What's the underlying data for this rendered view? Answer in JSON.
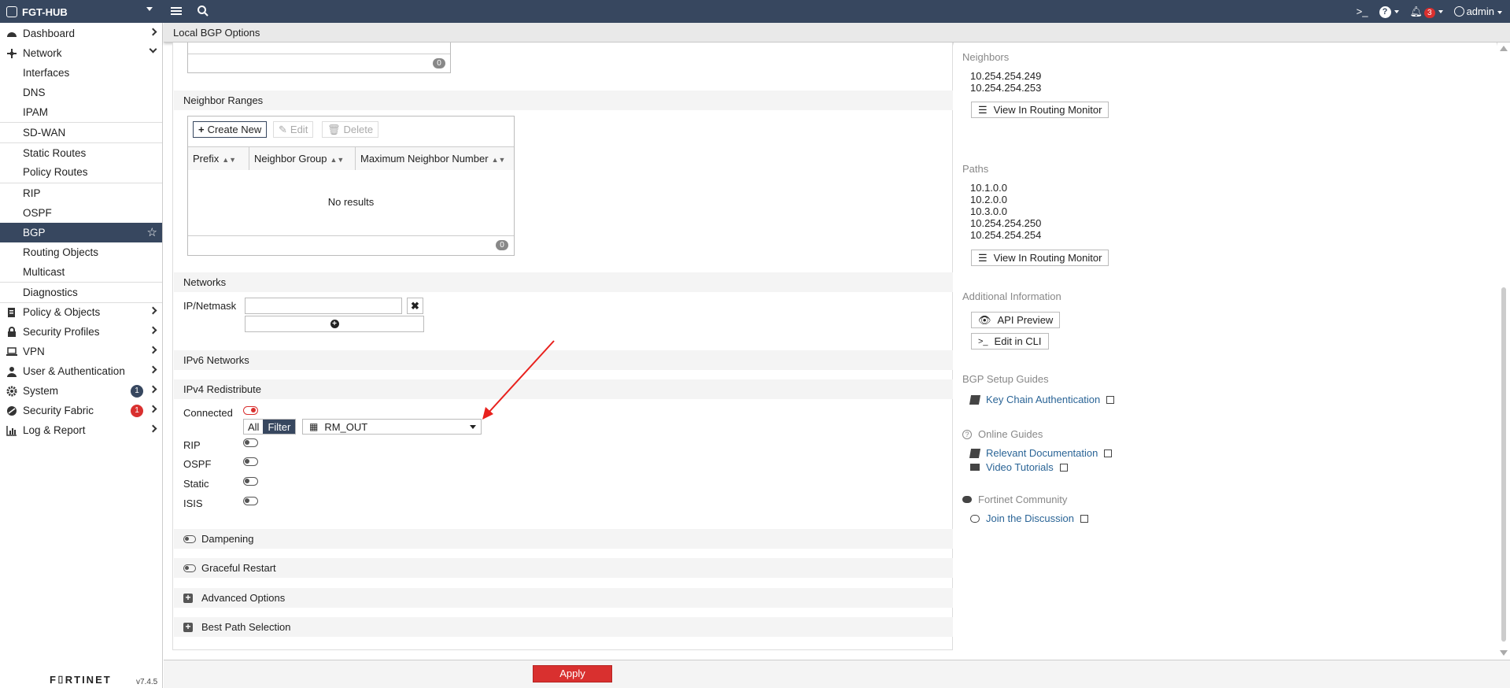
{
  "topbar": {
    "device_name": "FGT-HUB",
    "cli_label": ">_",
    "help_label": "?",
    "notification_count": "3",
    "user": "admin"
  },
  "sidebar": {
    "items": [
      {
        "label": "Dashboard"
      },
      {
        "label": "Network"
      },
      {
        "label": "Interfaces"
      },
      {
        "label": "DNS"
      },
      {
        "label": "IPAM"
      },
      {
        "label": "SD-WAN"
      },
      {
        "label": "Static Routes"
      },
      {
        "label": "Policy Routes"
      },
      {
        "label": "RIP"
      },
      {
        "label": "OSPF"
      },
      {
        "label": "BGP"
      },
      {
        "label": "Routing Objects"
      },
      {
        "label": "Multicast"
      },
      {
        "label": "Diagnostics"
      },
      {
        "label": "Policy & Objects"
      },
      {
        "label": "Security Profiles"
      },
      {
        "label": "VPN"
      },
      {
        "label": "User & Authentication"
      },
      {
        "label": "System",
        "badge": "1"
      },
      {
        "label": "Security Fabric",
        "badge": "1"
      },
      {
        "label": "Log & Report"
      }
    ],
    "logo": "F⌷RTINET",
    "version": "v7.4.5"
  },
  "page": {
    "title": "Local BGP Options",
    "top_count": "0",
    "neighbor_ranges": {
      "title": "Neighbor Ranges",
      "create_label": "Create New",
      "edit_label": "Edit",
      "delete_label": "Delete",
      "columns": [
        "Prefix",
        "Neighbor Group",
        "Maximum Neighbor Number"
      ],
      "empty_text": "No results",
      "count": "0"
    },
    "networks": {
      "title": "Networks",
      "ipnetmask_label": "IP/Netmask",
      "ipnetmask_value": ""
    },
    "ipv6_networks": {
      "title": "IPv6 Networks"
    },
    "ipv4_redistribute": {
      "title": "IPv4 Redistribute",
      "connected_label": "Connected",
      "all_label": "All",
      "filter_label": "Filter",
      "route_map": "RM_OUT",
      "rip_label": "RIP",
      "ospf_label": "OSPF",
      "static_label": "Static",
      "isis_label": "ISIS"
    },
    "dampening": "Dampening",
    "graceful_restart": "Graceful Restart",
    "advanced_options": "Advanced Options",
    "best_path_selection": "Best Path Selection",
    "apply_label": "Apply"
  },
  "right_panel": {
    "neighbors_title": "Neighbors",
    "neighbors": [
      "10.254.254.249",
      "10.254.254.253"
    ],
    "view_routing_monitor": "View In Routing Monitor",
    "paths_title": "Paths",
    "paths": [
      "10.1.0.0",
      "10.2.0.0",
      "10.3.0.0",
      "10.254.254.250",
      "10.254.254.254"
    ],
    "additional_info_title": "Additional Information",
    "api_preview": "API Preview",
    "edit_in_cli": "Edit in CLI",
    "setup_guides_title": "BGP Setup Guides",
    "key_chain_auth": "Key Chain Authentication",
    "online_guides_title": "Online Guides",
    "relevant_docs": "Relevant Documentation",
    "video_tutorials": "Video Tutorials",
    "community_title": "Fortinet Community",
    "join_discussion": "Join the Discussion"
  },
  "colors": {
    "topbar": "#37475f",
    "accent_red": "#d9302f",
    "link": "#2a6496"
  }
}
